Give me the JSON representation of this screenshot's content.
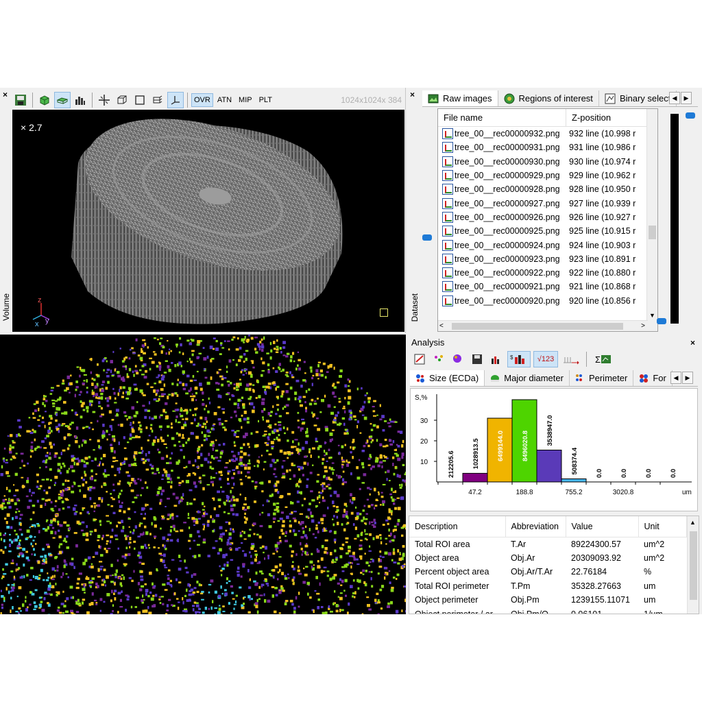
{
  "volume_panel": {
    "side_label": "Volume",
    "zoom": "× 2.7",
    "dims": "1024x1024x 384",
    "mode_buttons": [
      "OVR",
      "ATN",
      "MIP",
      "PLT"
    ],
    "axis_labels": {
      "z": "z",
      "x": "x",
      "y": "y"
    }
  },
  "dataset_panel": {
    "side_label": "Dataset",
    "tabs": [
      {
        "label": "Raw images",
        "icon": "raw-images-icon"
      },
      {
        "label": "Regions of interest",
        "icon": "roi-icon"
      },
      {
        "label": "Binary select",
        "icon": "binary-icon"
      }
    ],
    "columns": [
      "File name",
      "Z-position"
    ],
    "rows": [
      {
        "file": "tree_00__rec00000932.png",
        "z": "932 line (10.998 r"
      },
      {
        "file": "tree_00__rec00000931.png",
        "z": "931 line (10.986 r"
      },
      {
        "file": "tree_00__rec00000930.png",
        "z": "930 line (10.974 r"
      },
      {
        "file": "tree_00__rec00000929.png",
        "z": "929 line (10.962 r"
      },
      {
        "file": "tree_00__rec00000928.png",
        "z": "928 line (10.950 r"
      },
      {
        "file": "tree_00__rec00000927.png",
        "z": "927 line (10.939 r"
      },
      {
        "file": "tree_00__rec00000926.png",
        "z": "926 line (10.927 r"
      },
      {
        "file": "tree_00__rec00000925.png",
        "z": "925 line (10.915 r"
      },
      {
        "file": "tree_00__rec00000924.png",
        "z": "924 line (10.903 r"
      },
      {
        "file": "tree_00__rec00000923.png",
        "z": "923 line (10.891 r"
      },
      {
        "file": "tree_00__rec00000922.png",
        "z": "922 line (10.880 r"
      },
      {
        "file": "tree_00__rec00000921.png",
        "z": "921 line (10.868 r"
      },
      {
        "file": "tree_00__rec00000920.png",
        "z": "920 line (10.856 r"
      }
    ]
  },
  "analysis_panel": {
    "title": "Analysis",
    "toolbar_badge": "√123",
    "sigma": "Σ",
    "tabs": [
      {
        "label": "Size (ECDa)",
        "icon": "size-icon"
      },
      {
        "label": "Major diameter",
        "icon": "diameter-icon"
      },
      {
        "label": "Perimeter",
        "icon": "perimeter-icon"
      },
      {
        "label": "For",
        "icon": "form-icon"
      }
    ],
    "table": {
      "headers": [
        "Description",
        "Abbreviation",
        "Value",
        "Unit"
      ],
      "rows": [
        [
          "Total ROI area",
          "T.Ar",
          "89224300.57",
          "um^2"
        ],
        [
          "Object area",
          "Obj.Ar",
          "20309093.92",
          "um^2"
        ],
        [
          "Percent object area",
          "Obj.Ar/T.Ar",
          "22.76184",
          "%"
        ],
        [
          "Total ROI perimeter",
          "T.Pm",
          "35328.27663",
          "um"
        ],
        [
          "Object perimeter",
          "Obj.Pm",
          "1239155.11071",
          "um"
        ],
        [
          "Object perimeter / ar",
          "Obj.Pm/O",
          "0.06101",
          "1/um"
        ]
      ]
    }
  },
  "chart_data": {
    "type": "bar",
    "ylabel": "S,%",
    "xlabel": "um",
    "ylim": [
      0,
      40
    ],
    "yticks": [
      10,
      20,
      30
    ],
    "xtick_labels": [
      "47.2",
      "188.8",
      "755.2",
      "3020.8"
    ],
    "bin_labels": [
      "212205.6",
      "1028913.5",
      "6499144.0",
      "8496020.8",
      "3538947.0",
      "508374.4",
      "0.0",
      "0.0",
      "0.0",
      "0.0"
    ],
    "values": [
      0.0,
      4.2,
      31.0,
      40.0,
      15.5,
      1.5,
      0,
      0,
      0,
      0
    ],
    "colors": [
      "#800080",
      "#800080",
      "#f0b400",
      "#4ed400",
      "#5a3ab8",
      "#44b4f0",
      "#cccccc",
      "#cccccc",
      "#cccccc",
      "#cccccc"
    ]
  }
}
